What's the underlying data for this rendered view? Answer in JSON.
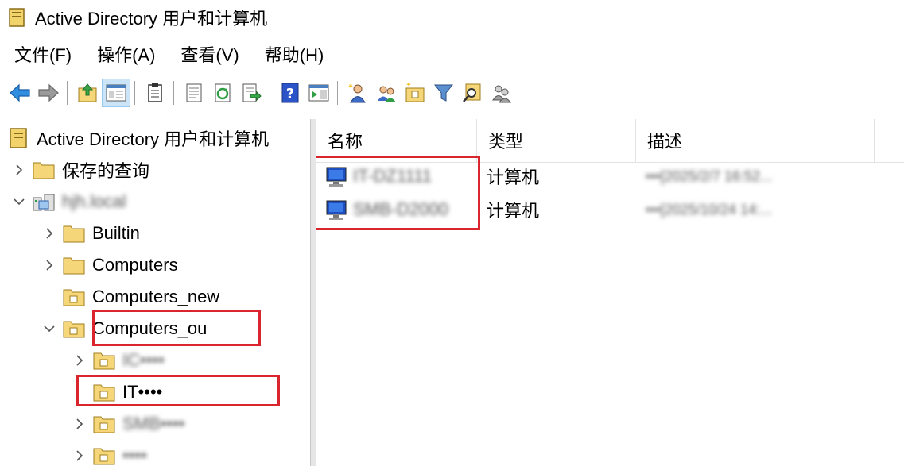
{
  "window": {
    "title": "Active Directory 用户和计算机"
  },
  "menu": {
    "items": [
      "文件(F)",
      "操作(A)",
      "查看(V)",
      "帮助(H)"
    ]
  },
  "tree": {
    "root": "Active Directory 用户和计算机",
    "saved_queries": "保存的查询",
    "domain": "hjh.local",
    "builtin": "Builtin",
    "computers": "Computers",
    "computers_new": "Computers_new",
    "computers_ou": "Computers_ou",
    "child_1": "IC••••",
    "child_2": "IT••••",
    "child_3": "SMB••••",
    "child_4": "••••"
  },
  "list": {
    "columns": {
      "name": "名称",
      "type": "类型",
      "description": "描述"
    },
    "rows": [
      {
        "name": "IT-DZ1111",
        "type": "计算机",
        "description": "•••[2025/2/7 16:52..."
      },
      {
        "name": "SMB-D2000",
        "type": "计算机",
        "description": "•••[2025/10/24 14:..."
      }
    ]
  },
  "colors": {
    "highlight_box": "#d9252e",
    "selected_tool": "#cce4f7",
    "folder": "#f5d77a"
  }
}
